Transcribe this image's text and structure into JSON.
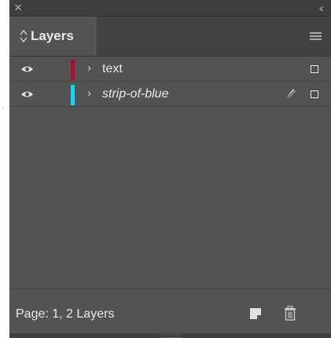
{
  "panel": {
    "title": "Layers",
    "close_glyph": "×",
    "collapse_glyph": "‹‹",
    "menu_icon": "hamburger-menu-icon"
  },
  "layers": [
    {
      "name": "text",
      "color": "#a0123c",
      "visible": true,
      "italic": false,
      "locked_icon": null
    },
    {
      "name": "strip-of-blue",
      "color": "#1fd3e6",
      "visible": true,
      "italic": true,
      "locked_icon": "pencil-struck-icon"
    }
  ],
  "footer": {
    "status": "Page: 1, 2 Layers",
    "new_layer_icon": "new-layer-icon",
    "delete_icon": "trash-icon"
  },
  "colors": {
    "panel_bg": "#535353",
    "header_bg": "#3e3e3e",
    "text": "#e8e8e8"
  }
}
